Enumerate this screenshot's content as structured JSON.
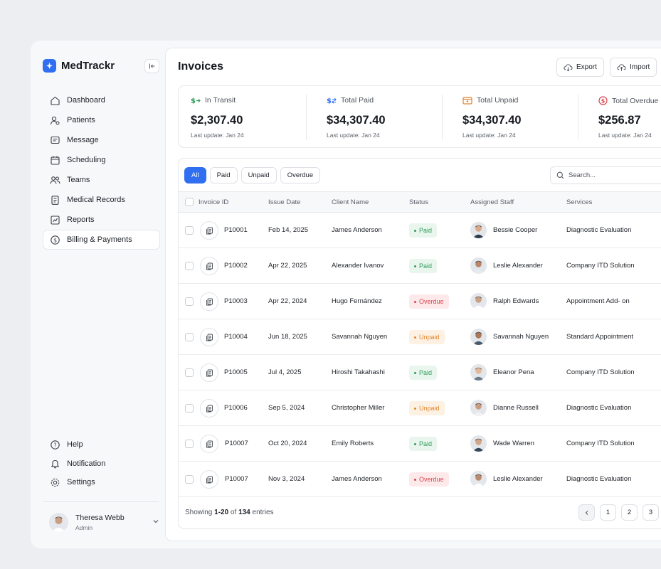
{
  "sidebar": {
    "brand": "MedTrackr",
    "nav": [
      {
        "label": "Dashboard",
        "icon": "home-icon"
      },
      {
        "label": "Patients",
        "icon": "patients-icon"
      },
      {
        "label": "Message",
        "icon": "message-icon"
      },
      {
        "label": "Scheduling",
        "icon": "calendar-icon"
      },
      {
        "label": "Teams",
        "icon": "teams-icon"
      },
      {
        "label": "Medical Records",
        "icon": "records-icon"
      },
      {
        "label": "Reports",
        "icon": "reports-icon"
      },
      {
        "label": "Billing & Payments",
        "icon": "billing-icon",
        "active": true
      }
    ],
    "bottom": [
      {
        "label": "Help",
        "icon": "help-icon"
      },
      {
        "label": "Notification",
        "icon": "bell-icon"
      },
      {
        "label": "Settings",
        "icon": "gear-icon"
      }
    ],
    "user": {
      "name": "Theresa Webb",
      "role": "Admin"
    }
  },
  "header": {
    "title": "Invoices",
    "export_label": "Export",
    "import_label": "Import"
  },
  "stats": [
    {
      "label": "In Transit",
      "value": "$2,307.40",
      "updated": "Last update: Jan 24",
      "color": "#2e9c5a"
    },
    {
      "label": "Total Paid",
      "value": "$34,307.40",
      "updated": "Last update: Jan 24",
      "color": "#2f6ff0"
    },
    {
      "label": "Total Unpaid",
      "value": "$34,307.40",
      "updated": "Last update: Jan 24",
      "color": "#e0862d"
    },
    {
      "label": "Total Overdue",
      "value": "$256.87",
      "updated": "Last update: Jan 24",
      "color": "#d9434e"
    }
  ],
  "filters": [
    "All",
    "Paid",
    "Unpaid",
    "Overdue"
  ],
  "search": {
    "placeholder": "Search..."
  },
  "table": {
    "columns": [
      "Invoice ID",
      "Issue Date",
      "Client Name",
      "Status",
      "Assigned Staff",
      "Services"
    ],
    "rows": [
      {
        "id": "P10001",
        "date": "Feb 14, 2025",
        "client": "James Anderson",
        "status": "Paid",
        "staff": "Bessie Cooper",
        "service": "Diagnostic Evaluation"
      },
      {
        "id": "P10002",
        "date": "Apr 22, 2025",
        "client": "Alexander Ivanov",
        "status": "Paid",
        "staff": "Leslie Alexander",
        "service": "Company ITD Solution"
      },
      {
        "id": "P10003",
        "date": "Apr 22, 2024",
        "client": "Hugo Fernández",
        "status": "Overdue",
        "staff": "Ralph Edwards",
        "service": "Appointment Add- on"
      },
      {
        "id": "P10004",
        "date": "Jun 18, 2025",
        "client": "Savannah Nguyen",
        "status": "Unpaid",
        "staff": "Savannah Nguyen",
        "service": "Standard Appointment"
      },
      {
        "id": "P10005",
        "date": "Jul 4, 2025",
        "client": "Hiroshi Takahashi",
        "status": "Paid",
        "staff": "Eleanor Pena",
        "service": "Company ITD Solution"
      },
      {
        "id": "P10006",
        "date": "Sep 5, 2024",
        "client": "Christopher Miller",
        "status": "Unpaid",
        "staff": "Dianne Russell",
        "service": "Diagnostic Evaluation"
      },
      {
        "id": "P10007",
        "date": "Oct 20, 2024",
        "client": "Emily Roberts",
        "status": "Paid",
        "staff": "Wade Warren",
        "service": "Company ITD Solution"
      },
      {
        "id": "P10007",
        "date": "Nov 3, 2024",
        "client": "James Anderson",
        "status": "Overdue",
        "staff": "Leslie Alexander",
        "service": "Diagnostic Evaluation"
      }
    ]
  },
  "footer": {
    "prefix": "Showing ",
    "range": "1-20",
    "of": " of ",
    "total": "134",
    "suffix": " entries"
  },
  "pagination": [
    "1",
    "2",
    "3"
  ]
}
